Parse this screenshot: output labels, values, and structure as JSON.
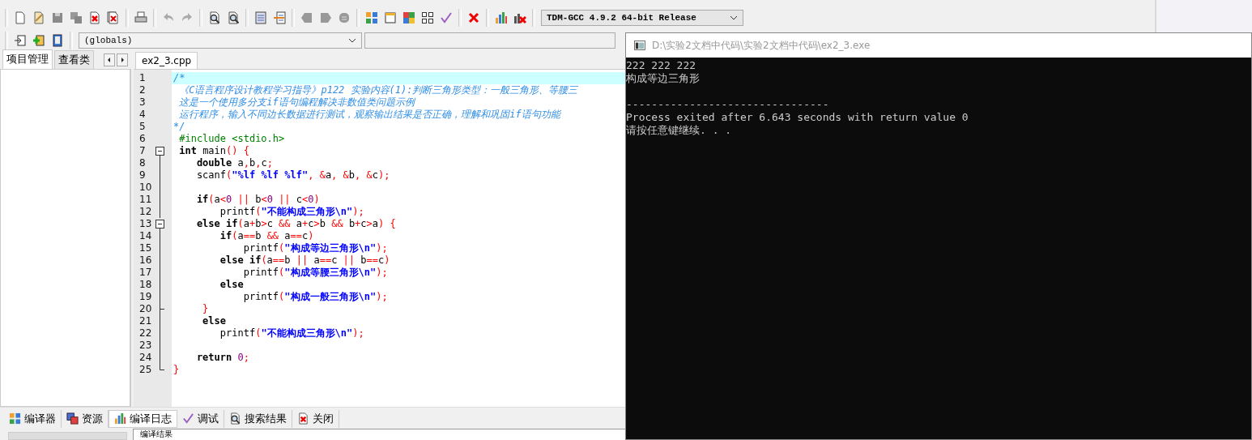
{
  "toolbar": {
    "compiler": "TDM-GCC 4.9.2 64-bit Release",
    "scope": "(globals)"
  },
  "left_panel": {
    "tabs": [
      {
        "label": "项目管理",
        "selected": true
      },
      {
        "label": "查看类",
        "selected": false
      }
    ]
  },
  "editor": {
    "tabs": [
      {
        "label": "ex2_3.cpp",
        "selected": true
      }
    ],
    "lines": [
      {
        "number": "1",
        "current": true,
        "kind": "plain",
        "tokens": [
          {
            "kind": "c",
            "t": "/*"
          }
        ]
      },
      {
        "number": "2",
        "current": false,
        "kind": "plain",
        "tokens": [
          {
            "kind": "c",
            "t": " 《C语言程序设计教程学习指导》p122 实验内容(1):判断三角形类型：一般三角形、等腰三"
          }
        ]
      },
      {
        "number": "3",
        "current": false,
        "kind": "plain",
        "tokens": [
          {
            "kind": "c",
            "t": " 这是一个使用多分支if语句编程解决非数值类问题示例"
          }
        ]
      },
      {
        "number": "4",
        "current": false,
        "kind": "plain",
        "tokens": [
          {
            "kind": "c",
            "t": " 运行程序，输入不同边长数据进行测试，观察输出结果是否正确，理解和巩固if语句功能"
          }
        ]
      },
      {
        "number": "5",
        "current": false,
        "kind": "plain",
        "tokens": [
          {
            "kind": "c",
            "t": "*/"
          }
        ]
      },
      {
        "number": "6",
        "current": false,
        "kind": "plain",
        "tokens": [
          {
            "kind": "pp",
            "t": " #include <stdio.h>"
          }
        ]
      },
      {
        "number": "7",
        "current": false,
        "kind": "fold_open",
        "tokens": [
          {
            "kind": "kw",
            "t": " int"
          },
          {
            "kind": "t",
            "t": " main"
          },
          {
            "kind": "p",
            "t": "() {"
          }
        ]
      },
      {
        "number": "8",
        "current": false,
        "kind": "fold_line",
        "tokens": [
          {
            "kind": "kw",
            "t": "    double"
          },
          {
            "kind": "t",
            "t": " a"
          },
          {
            "kind": "p",
            "t": ","
          },
          {
            "kind": "t",
            "t": "b"
          },
          {
            "kind": "p",
            "t": ","
          },
          {
            "kind": "t",
            "t": "c"
          },
          {
            "kind": "p",
            "t": ";"
          }
        ]
      },
      {
        "number": "9",
        "current": false,
        "kind": "fold_line",
        "tokens": [
          {
            "kind": "t",
            "t": "    scanf"
          },
          {
            "kind": "p",
            "t": "("
          },
          {
            "kind": "s",
            "t": "\"%lf %lf %lf\""
          },
          {
            "kind": "p",
            "t": ", &"
          },
          {
            "kind": "t",
            "t": "a"
          },
          {
            "kind": "p",
            "t": ", &"
          },
          {
            "kind": "t",
            "t": "b"
          },
          {
            "kind": "p",
            "t": ", &"
          },
          {
            "kind": "t",
            "t": "c"
          },
          {
            "kind": "p",
            "t": ");"
          }
        ]
      },
      {
        "number": "10",
        "current": false,
        "kind": "fold_line"
      },
      {
        "number": "11",
        "current": false,
        "kind": "fold_line",
        "tokens": [
          {
            "kind": "kw",
            "t": "    if"
          },
          {
            "kind": "p",
            "t": "("
          },
          {
            "kind": "t",
            "t": "a"
          },
          {
            "kind": "p",
            "t": "<"
          },
          {
            "kind": "n",
            "t": "0"
          },
          {
            "kind": "p",
            "t": " || "
          },
          {
            "kind": "t",
            "t": "b"
          },
          {
            "kind": "p",
            "t": "<"
          },
          {
            "kind": "n",
            "t": "0"
          },
          {
            "kind": "p",
            "t": " || "
          },
          {
            "kind": "t",
            "t": "c"
          },
          {
            "kind": "p",
            "t": "<"
          },
          {
            "kind": "n",
            "t": "0"
          },
          {
            "kind": "p",
            "t": ")"
          }
        ]
      },
      {
        "number": "12",
        "current": false,
        "kind": "fold_line",
        "tokens": [
          {
            "kind": "t",
            "t": "        printf"
          },
          {
            "kind": "p",
            "t": "("
          },
          {
            "kind": "s",
            "t": "\"不能构成三角形\\n\""
          },
          {
            "kind": "p",
            "t": ");"
          }
        ]
      },
      {
        "number": "13",
        "current": false,
        "kind": "fold_open",
        "tokens": [
          {
            "kind": "kw",
            "t": "    else if"
          },
          {
            "kind": "p",
            "t": "("
          },
          {
            "kind": "t",
            "t": "a"
          },
          {
            "kind": "p",
            "t": "+"
          },
          {
            "kind": "t",
            "t": "b"
          },
          {
            "kind": "p",
            "t": ">"
          },
          {
            "kind": "t",
            "t": "c"
          },
          {
            "kind": "p",
            "t": " && "
          },
          {
            "kind": "t",
            "t": "a"
          },
          {
            "kind": "p",
            "t": "+"
          },
          {
            "kind": "t",
            "t": "c"
          },
          {
            "kind": "p",
            "t": ">"
          },
          {
            "kind": "t",
            "t": "b"
          },
          {
            "kind": "p",
            "t": " && "
          },
          {
            "kind": "t",
            "t": "b"
          },
          {
            "kind": "p",
            "t": "+"
          },
          {
            "kind": "t",
            "t": "c"
          },
          {
            "kind": "p",
            "t": ">"
          },
          {
            "kind": "t",
            "t": "a"
          },
          {
            "kind": "p",
            "t": ") {"
          }
        ]
      },
      {
        "number": "14",
        "current": false,
        "kind": "fold_line",
        "tokens": [
          {
            "kind": "kw",
            "t": "        if"
          },
          {
            "kind": "p",
            "t": "("
          },
          {
            "kind": "t",
            "t": "a"
          },
          {
            "kind": "p",
            "t": "=="
          },
          {
            "kind": "t",
            "t": "b"
          },
          {
            "kind": "p",
            "t": " && "
          },
          {
            "kind": "t",
            "t": "a"
          },
          {
            "kind": "p",
            "t": "=="
          },
          {
            "kind": "t",
            "t": "c"
          },
          {
            "kind": "p",
            "t": ")"
          }
        ]
      },
      {
        "number": "15",
        "current": false,
        "kind": "fold_line",
        "tokens": [
          {
            "kind": "t",
            "t": "            printf"
          },
          {
            "kind": "p",
            "t": "("
          },
          {
            "kind": "s",
            "t": "\"构成等边三角形\\n\""
          },
          {
            "kind": "p",
            "t": ");"
          }
        ]
      },
      {
        "number": "16",
        "current": false,
        "kind": "fold_line",
        "tokens": [
          {
            "kind": "kw",
            "t": "        else if"
          },
          {
            "kind": "p",
            "t": "("
          },
          {
            "kind": "t",
            "t": "a"
          },
          {
            "kind": "p",
            "t": "=="
          },
          {
            "kind": "t",
            "t": "b"
          },
          {
            "kind": "p",
            "t": " || "
          },
          {
            "kind": "t",
            "t": "a"
          },
          {
            "kind": "p",
            "t": "=="
          },
          {
            "kind": "t",
            "t": "c"
          },
          {
            "kind": "p",
            "t": " || "
          },
          {
            "kind": "t",
            "t": "b"
          },
          {
            "kind": "p",
            "t": "=="
          },
          {
            "kind": "t",
            "t": "c"
          },
          {
            "kind": "p",
            "t": ")"
          }
        ]
      },
      {
        "number": "17",
        "current": false,
        "kind": "fold_line",
        "tokens": [
          {
            "kind": "t",
            "t": "            printf"
          },
          {
            "kind": "p",
            "t": "("
          },
          {
            "kind": "s",
            "t": "\"构成等腰三角形\\n\""
          },
          {
            "kind": "p",
            "t": ");"
          }
        ]
      },
      {
        "number": "18",
        "current": false,
        "kind": "fold_line",
        "tokens": [
          {
            "kind": "kw",
            "t": "        else"
          }
        ]
      },
      {
        "number": "19",
        "current": false,
        "kind": "fold_line",
        "tokens": [
          {
            "kind": "t",
            "t": "            printf"
          },
          {
            "kind": "p",
            "t": "("
          },
          {
            "kind": "s",
            "t": "\"构成一般三角形\\n\""
          },
          {
            "kind": "p",
            "t": ");"
          }
        ]
      },
      {
        "number": "20",
        "current": false,
        "kind": "fold_tee",
        "tokens": [
          {
            "kind": "p",
            "t": "     }"
          }
        ]
      },
      {
        "number": "21",
        "current": false,
        "kind": "fold_line",
        "tokens": [
          {
            "kind": "kw",
            "t": "     else"
          }
        ]
      },
      {
        "number": "22",
        "current": false,
        "kind": "fold_line",
        "tokens": [
          {
            "kind": "t",
            "t": "        printf"
          },
          {
            "kind": "p",
            "t": "("
          },
          {
            "kind": "s",
            "t": "\"不能构成三角形\\n\""
          },
          {
            "kind": "p",
            "t": ");"
          }
        ]
      },
      {
        "number": "23",
        "current": false,
        "kind": "fold_line"
      },
      {
        "number": "24",
        "current": false,
        "kind": "fold_line",
        "tokens": [
          {
            "kind": "kw",
            "t": "    return"
          },
          {
            "kind": "n",
            "t": " 0"
          },
          {
            "kind": "p",
            "t": ";"
          }
        ]
      },
      {
        "number": "25",
        "current": false,
        "kind": "fold_end",
        "tokens": [
          {
            "kind": "p",
            "t": "}"
          }
        ]
      }
    ]
  },
  "bottom_tabs": [
    {
      "label": "编译器",
      "selected": false
    },
    {
      "label": "资源",
      "selected": false
    },
    {
      "label": "编译日志",
      "selected": true
    },
    {
      "label": "调试",
      "selected": false
    },
    {
      "label": "搜索结果",
      "selected": false
    },
    {
      "label": "关闭",
      "selected": false
    }
  ],
  "compile_result": {
    "label": "编译结果"
  },
  "console": {
    "title": "D:\\实验2文档中代码\\实验2文档中代码\\ex2_3.exe",
    "output": [
      "222 222 222",
      "构成等边三角形"
    ],
    "footer": [
      "--------------------------------",
      "Process exited after 6.643 seconds with return value 0",
      "请按任意键继续. . ."
    ]
  }
}
